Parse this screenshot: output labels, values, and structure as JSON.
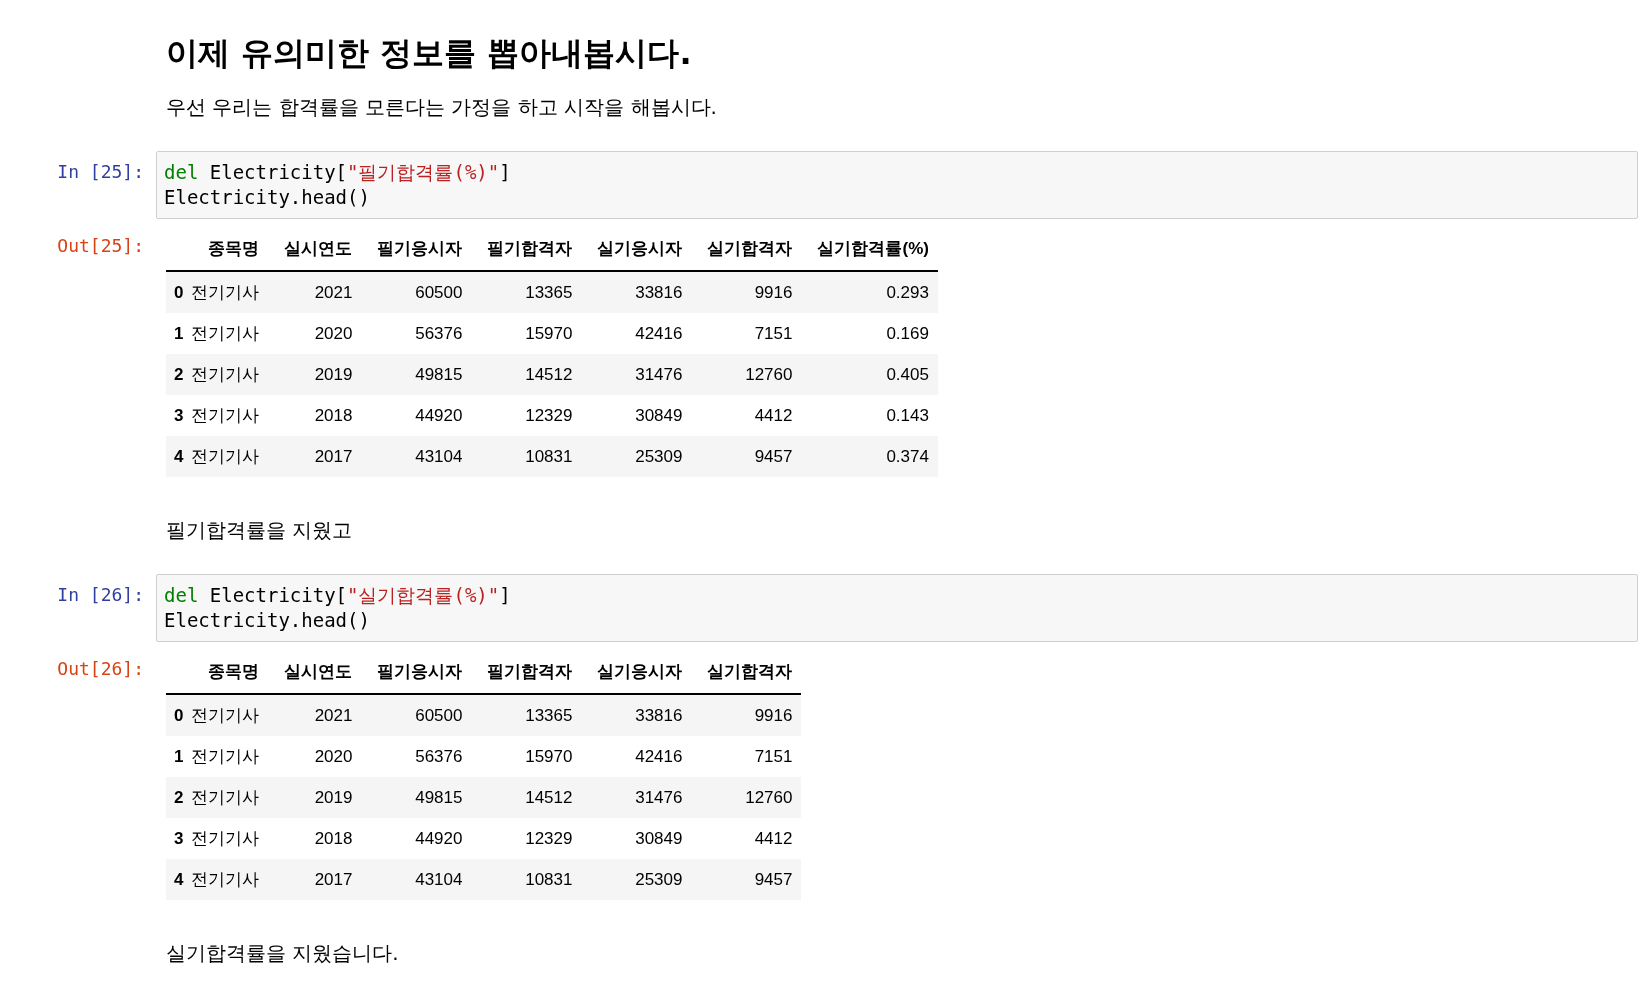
{
  "cells": [
    {
      "kind": "markdown",
      "heading": "이제 유의미한 정보를 뽑아내봅시다.",
      "paragraph": "우선 우리는 합격률을 모른다는 가정을 하고 시작을 해봅시다."
    },
    {
      "kind": "code",
      "prompt": "In [25]:",
      "lines": [
        [
          {
            "kind": "keyword",
            "text": "del"
          },
          {
            "kind": "plain",
            "text": " Electricity["
          },
          {
            "kind": "string",
            "text": "\"필기합격률(%)\""
          },
          {
            "kind": "plain",
            "text": "]"
          }
        ],
        [
          {
            "kind": "plain",
            "text": "Electricity.head()"
          }
        ]
      ]
    },
    {
      "kind": "output",
      "prompt": "Out[25]:",
      "columns": [
        "종목명",
        "실시연도",
        "필기응시자",
        "필기합격자",
        "실기응시자",
        "실기합격자",
        "실기합격률(%)"
      ],
      "rows": [
        {
          "index": "0",
          "cells": [
            "전기기사",
            "2021",
            "60500",
            "13365",
            "33816",
            "9916",
            "0.293"
          ]
        },
        {
          "index": "1",
          "cells": [
            "전기기사",
            "2020",
            "56376",
            "15970",
            "42416",
            "7151",
            "0.169"
          ]
        },
        {
          "index": "2",
          "cells": [
            "전기기사",
            "2019",
            "49815",
            "14512",
            "31476",
            "12760",
            "0.405"
          ]
        },
        {
          "index": "3",
          "cells": [
            "전기기사",
            "2018",
            "44920",
            "12329",
            "30849",
            "4412",
            "0.143"
          ]
        },
        {
          "index": "4",
          "cells": [
            "전기기사",
            "2017",
            "43104",
            "10831",
            "25309",
            "9457",
            "0.374"
          ]
        }
      ]
    },
    {
      "kind": "markdown",
      "paragraph": "필기합격률을 지웠고"
    },
    {
      "kind": "code",
      "prompt": "In [26]:",
      "lines": [
        [
          {
            "kind": "keyword",
            "text": "del"
          },
          {
            "kind": "plain",
            "text": " Electricity["
          },
          {
            "kind": "string",
            "text": "\"실기합격률(%)\""
          },
          {
            "kind": "plain",
            "text": "]"
          }
        ],
        [
          {
            "kind": "plain",
            "text": "Electricity.head()"
          }
        ]
      ]
    },
    {
      "kind": "output",
      "prompt": "Out[26]:",
      "columns": [
        "종목명",
        "실시연도",
        "필기응시자",
        "필기합격자",
        "실기응시자",
        "실기합격자"
      ],
      "rows": [
        {
          "index": "0",
          "cells": [
            "전기기사",
            "2021",
            "60500",
            "13365",
            "33816",
            "9916"
          ]
        },
        {
          "index": "1",
          "cells": [
            "전기기사",
            "2020",
            "56376",
            "15970",
            "42416",
            "7151"
          ]
        },
        {
          "index": "2",
          "cells": [
            "전기기사",
            "2019",
            "49815",
            "14512",
            "31476",
            "12760"
          ]
        },
        {
          "index": "3",
          "cells": [
            "전기기사",
            "2018",
            "44920",
            "12329",
            "30849",
            "4412"
          ]
        },
        {
          "index": "4",
          "cells": [
            "전기기사",
            "2017",
            "43104",
            "10831",
            "25309",
            "9457"
          ]
        }
      ]
    },
    {
      "kind": "markdown",
      "paragraph": "실기합격률을 지웠습니다."
    }
  ]
}
